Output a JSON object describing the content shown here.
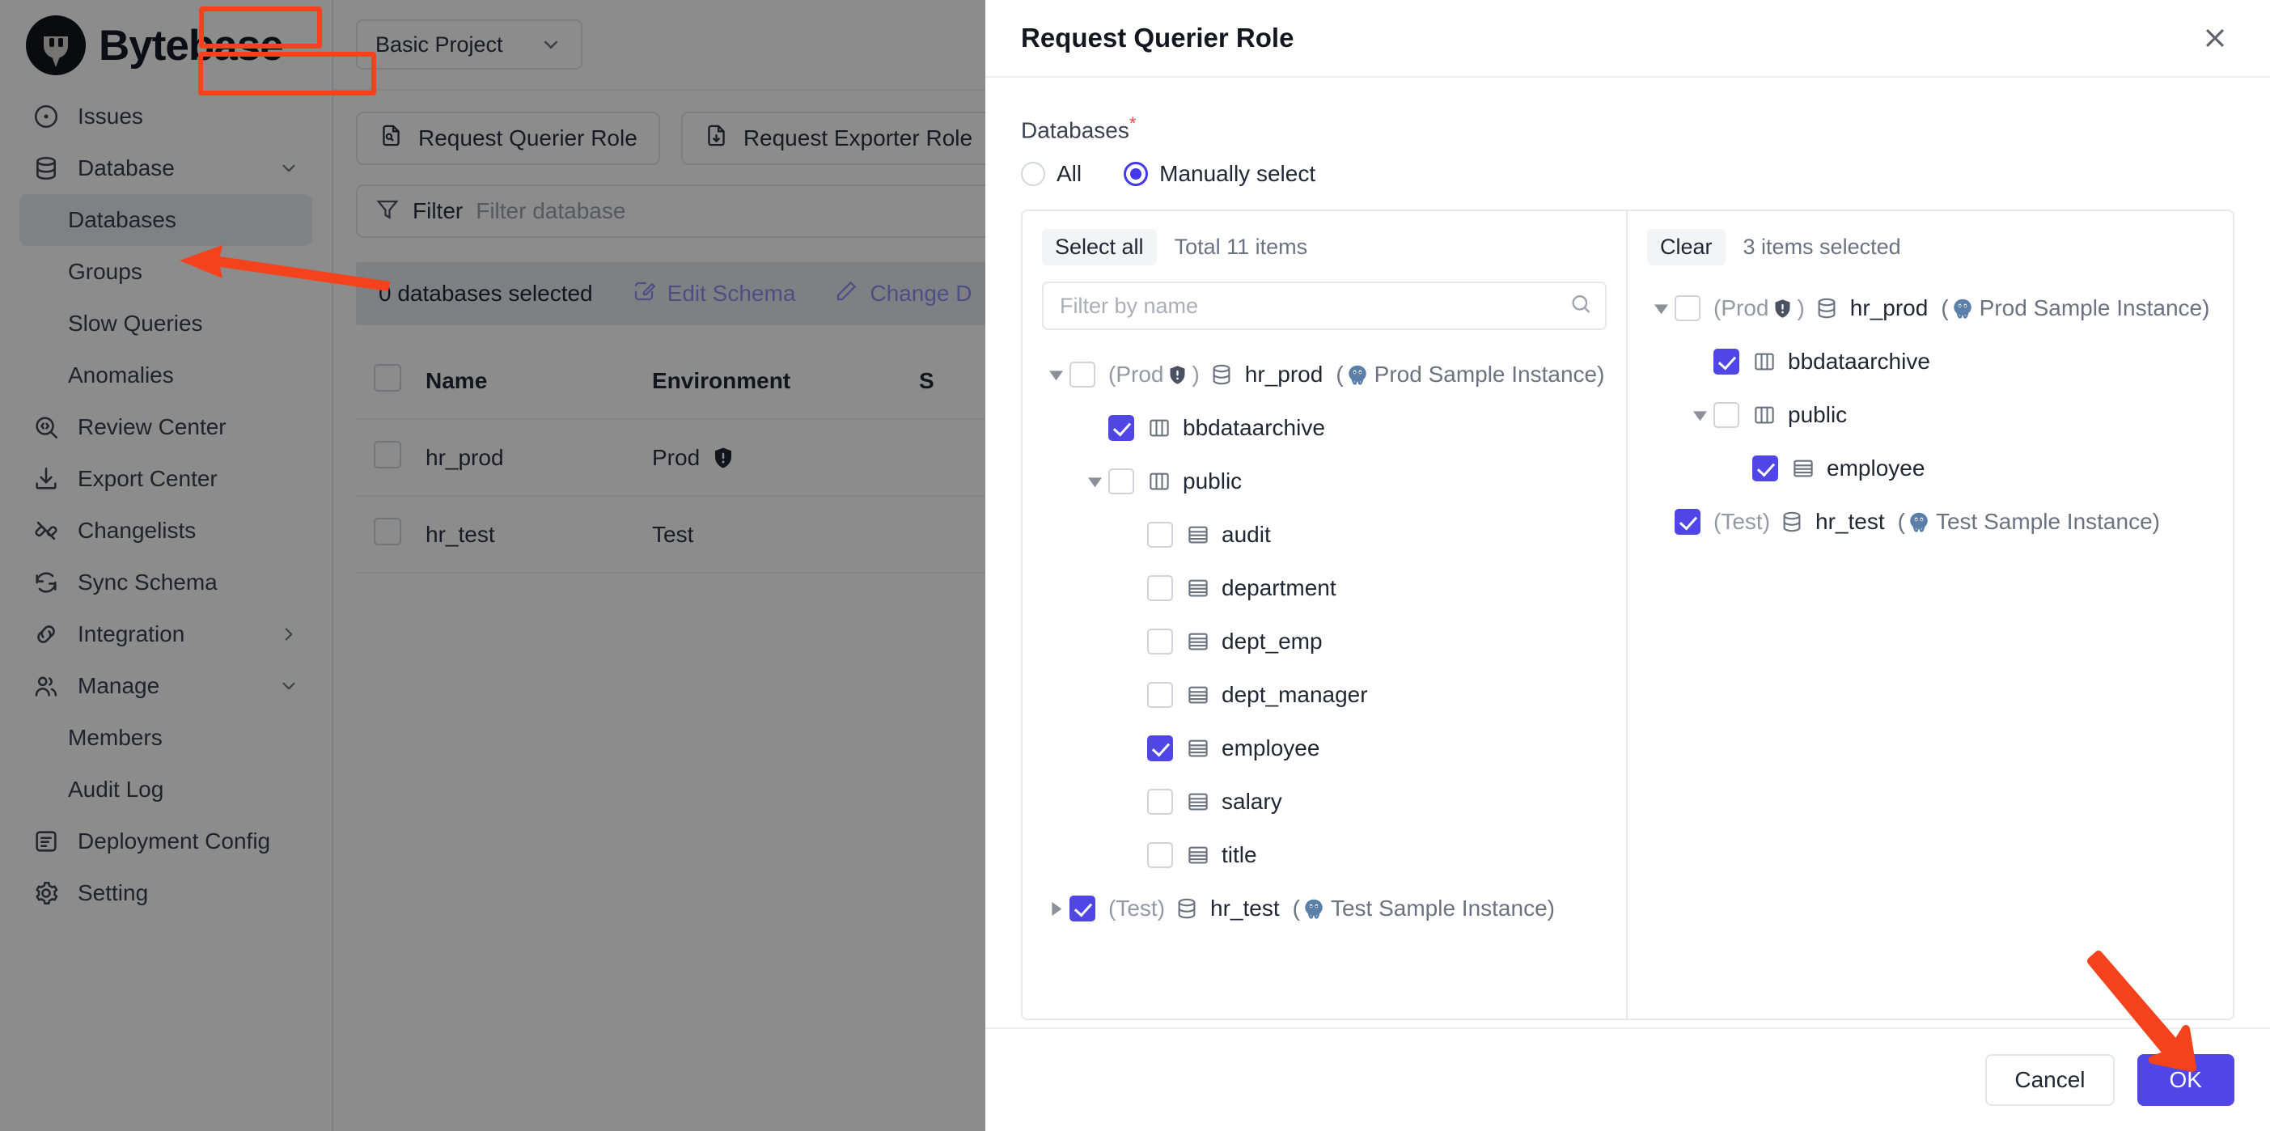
{
  "brand": {
    "name": "Bytebase",
    "accent": "#4f46e5",
    "annotation_color": "#f4431c"
  },
  "sidebar": {
    "items": [
      {
        "label": "Issues",
        "icon": "target-icon",
        "level": 0,
        "chevron": "",
        "active": false
      },
      {
        "label": "Database",
        "icon": "database-icon",
        "level": 0,
        "chevron": "down",
        "active": false
      },
      {
        "label": "Databases",
        "icon": "",
        "level": 1,
        "chevron": "",
        "active": true
      },
      {
        "label": "Groups",
        "icon": "",
        "level": 1,
        "chevron": "",
        "active": false
      },
      {
        "label": "Slow Queries",
        "icon": "",
        "level": 1,
        "chevron": "",
        "active": false
      },
      {
        "label": "Anomalies",
        "icon": "",
        "level": 1,
        "chevron": "",
        "active": false
      },
      {
        "label": "Review Center",
        "icon": "code-search-icon",
        "level": 0,
        "chevron": "",
        "active": false
      },
      {
        "label": "Export Center",
        "icon": "download-icon",
        "level": 0,
        "chevron": "",
        "active": false
      },
      {
        "label": "Changelists",
        "icon": "changelist-icon",
        "level": 0,
        "chevron": "",
        "active": false
      },
      {
        "label": "Sync Schema",
        "icon": "sync-icon",
        "level": 0,
        "chevron": "",
        "active": false
      },
      {
        "label": "Integration",
        "icon": "link-icon",
        "level": 0,
        "chevron": "right",
        "active": false
      },
      {
        "label": "Manage",
        "icon": "users-icon",
        "level": 0,
        "chevron": "down",
        "active": false
      },
      {
        "label": "Members",
        "icon": "",
        "level": 1,
        "chevron": "",
        "active": false
      },
      {
        "label": "Audit Log",
        "icon": "",
        "level": 1,
        "chevron": "",
        "active": false
      },
      {
        "label": "Deployment Config",
        "icon": "doc-lines-icon",
        "level": 0,
        "chevron": "",
        "active": false
      },
      {
        "label": "Setting",
        "icon": "gear-icon",
        "level": 0,
        "chevron": "",
        "active": false
      }
    ]
  },
  "main": {
    "project_selector": {
      "value": "Basic Project"
    },
    "role_buttons": [
      {
        "label": "Request Querier Role",
        "icon": "file-search-icon"
      },
      {
        "label": "Request Exporter Role",
        "icon": "file-download-icon"
      }
    ],
    "filter": {
      "label": "Filter",
      "placeholder": "Filter database"
    },
    "selection_bar": {
      "count_text": "0 databases selected",
      "actions": [
        {
          "label": "Edit Schema",
          "icon": "edit-square-icon"
        },
        {
          "label": "Change D",
          "icon": "pencil-icon"
        }
      ]
    },
    "table": {
      "columns": [
        "Name",
        "Environment",
        "S"
      ],
      "rows": [
        {
          "name": "hr_prod",
          "environment": "Prod",
          "protected": true
        },
        {
          "name": "hr_test",
          "environment": "Test",
          "protected": false
        }
      ]
    }
  },
  "modal": {
    "title": "Request Querier Role",
    "close_icon": "close-icon",
    "databases_label": "Databases",
    "required_marker": "*",
    "radio_options": [
      {
        "label": "All",
        "selected": false
      },
      {
        "label": "Manually select",
        "selected": true
      }
    ],
    "left_panel": {
      "select_all_label": "Select all",
      "total_text": "Total 11 items",
      "search_placeholder": "Filter by name",
      "search_value": "",
      "tree": [
        {
          "indent": 0,
          "twist": "down",
          "checked": false,
          "env": "(Prod",
          "shield": true,
          "env_close": ")",
          "icon": "database-icon",
          "label": "hr_prod",
          "instance": "Prod Sample Instance",
          "instance_icon": "postgres-icon"
        },
        {
          "indent": 1,
          "twist": "none",
          "checked": true,
          "icon": "schema-icon",
          "label": "bbdataarchive"
        },
        {
          "indent": 1,
          "twist": "down",
          "checked": false,
          "icon": "schema-icon",
          "label": "public"
        },
        {
          "indent": 2,
          "twist": "none",
          "checked": false,
          "icon": "table-icon",
          "label": "audit"
        },
        {
          "indent": 2,
          "twist": "none",
          "checked": false,
          "icon": "table-icon",
          "label": "department"
        },
        {
          "indent": 2,
          "twist": "none",
          "checked": false,
          "icon": "table-icon",
          "label": "dept_emp"
        },
        {
          "indent": 2,
          "twist": "none",
          "checked": false,
          "icon": "table-icon",
          "label": "dept_manager"
        },
        {
          "indent": 2,
          "twist": "none",
          "checked": true,
          "icon": "table-icon",
          "label": "employee"
        },
        {
          "indent": 2,
          "twist": "none",
          "checked": false,
          "icon": "table-icon",
          "label": "salary"
        },
        {
          "indent": 2,
          "twist": "none",
          "checked": false,
          "icon": "table-icon",
          "label": "title"
        },
        {
          "indent": 0,
          "twist": "right",
          "checked": true,
          "env": "(Test",
          "shield": false,
          "env_close": ")",
          "icon": "database-icon",
          "label": "hr_test",
          "instance": "Test Sample Instance",
          "instance_icon": "postgres-icon"
        }
      ]
    },
    "right_panel": {
      "clear_label": "Clear",
      "selected_text": "3 items selected",
      "tree": [
        {
          "indent": 0,
          "twist": "down",
          "checked": false,
          "env": "(Prod",
          "shield": true,
          "env_close": ")",
          "icon": "database-icon",
          "label": "hr_prod",
          "instance": "Prod Sample Instance",
          "instance_icon": "postgres-icon"
        },
        {
          "indent": 1,
          "twist": "none",
          "checked": true,
          "icon": "schema-icon",
          "label": "bbdataarchive"
        },
        {
          "indent": 1,
          "twist": "down",
          "checked": false,
          "icon": "schema-icon",
          "label": "public"
        },
        {
          "indent": 2,
          "twist": "none",
          "checked": true,
          "icon": "table-icon",
          "label": "employee"
        },
        {
          "indent": 0,
          "twist": "none",
          "checked": true,
          "env": "(Test",
          "shield": false,
          "env_close": ")",
          "icon": "database-icon",
          "label": "hr_test",
          "instance": "Test Sample Instance",
          "instance_icon": "postgres-icon"
        }
      ]
    },
    "footer": {
      "cancel_label": "Cancel",
      "ok_label": "OK"
    }
  }
}
